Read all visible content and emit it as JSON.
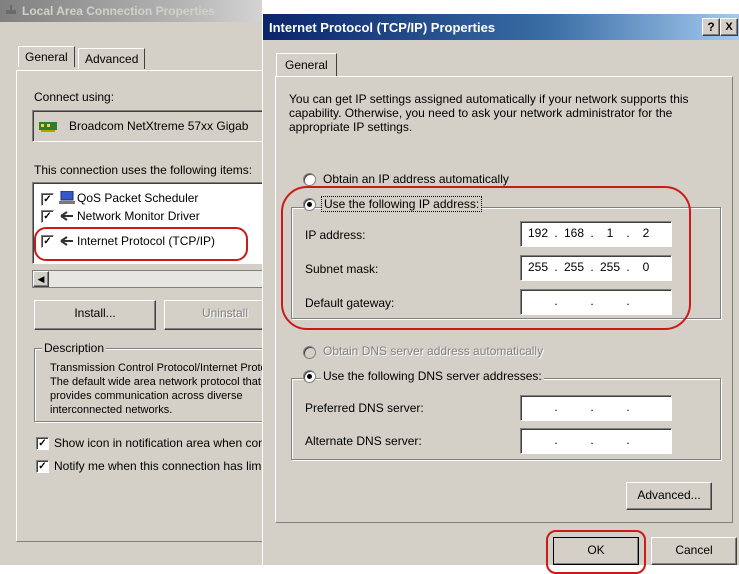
{
  "left_window": {
    "title": "Local Area Connection Properties",
    "tabs": [
      "General",
      "Advanced"
    ],
    "connect_using_label": "Connect using:",
    "adapter_name": "Broadcom NetXtreme 57xx Gigab",
    "components_label": "This connection uses the following items:",
    "components": [
      "QoS Packet Scheduler",
      "Network Monitor Driver",
      "Internet Protocol (TCP/IP)"
    ],
    "install_label": "Install...",
    "uninstall_label": "Uninstall",
    "description_label": "Description",
    "description_text": "Transmission Control Protocol/Internet Protocol. The default wide area network protocol that provides communication across diverse interconnected networks.",
    "show_icon_label": "Show icon in notification area when connected",
    "notify_label": "Notify me when this connection has limited or no connectivity"
  },
  "tcpip_dialog": {
    "title": "Internet Protocol (TCP/IP) Properties",
    "help_glyph": "?",
    "close_glyph": "X",
    "tab_general": "General",
    "intro_text": "You can get IP settings assigned automatically if your network supports this capability. Otherwise, you need to ask your network administrator for the appropriate IP settings.",
    "obtain_ip_label": "Obtain an IP address automatically",
    "use_ip_label": "Use the following IP address:",
    "ip_address_label": "IP address:",
    "ip_address": [
      "192",
      "168",
      "1",
      "2"
    ],
    "subnet_label": "Subnet mask:",
    "subnet_mask": [
      "255",
      "255",
      "255",
      "0"
    ],
    "gateway_label": "Default gateway:",
    "gateway": [
      "",
      "",
      "",
      ""
    ],
    "obtain_dns_label": "Obtain DNS server address automatically",
    "use_dns_label": "Use the following DNS server addresses:",
    "preferred_dns_label": "Preferred DNS server:",
    "alternate_dns_label": "Alternate DNS server:",
    "preferred_dns": [
      "",
      "",
      "",
      ""
    ],
    "alternate_dns": [
      "",
      "",
      "",
      ""
    ],
    "advanced_label": "Advanced...",
    "ok_label": "OK",
    "cancel_label": "Cancel"
  },
  "colors": {
    "highlight_red": "#cc1a1a",
    "title_active": "#0a246a",
    "face": "#d4d0c8"
  }
}
